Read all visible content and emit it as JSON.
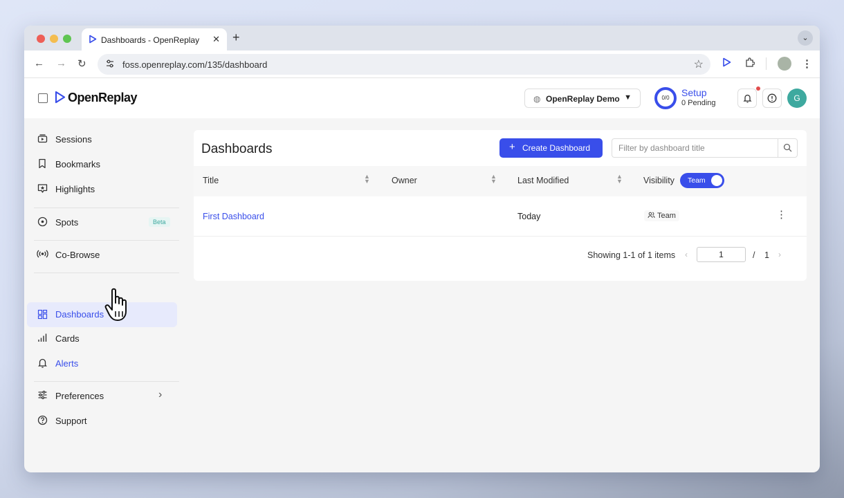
{
  "browser": {
    "tab_title": "Dashboards - OpenReplay",
    "tab_close": "✕",
    "new_tab": "+",
    "tab_menu": "⌄",
    "url": "foss.openreplay.com/135/dashboard"
  },
  "header": {
    "logo": "OpenReplay",
    "project": "OpenReplay Demo",
    "setup_progress": "0/0",
    "setup_title": "Setup",
    "setup_sub": "0 Pending",
    "user_initial": "G"
  },
  "sidebar": {
    "items": [
      {
        "label": "Sessions",
        "icon": "sessions-icon"
      },
      {
        "label": "Bookmarks",
        "icon": "bookmark-icon"
      },
      {
        "label": "Highlights",
        "icon": "highlights-icon"
      },
      {
        "label": "Spots",
        "icon": "spot-icon",
        "badge": "Beta"
      },
      {
        "label": "Co-Browse",
        "icon": "broadcast-icon"
      },
      {
        "label": "Dashboards",
        "icon": "dashboard-icon",
        "active": true
      },
      {
        "label": "Cards",
        "icon": "bar-chart-icon"
      },
      {
        "label": "Alerts",
        "icon": "bell-icon"
      },
      {
        "label": "Preferences",
        "icon": "sliders-icon"
      },
      {
        "label": "Support",
        "icon": "help-icon"
      }
    ]
  },
  "main": {
    "title": "Dashboards",
    "create_button": "Create Dashboard",
    "filter_placeholder": "Filter by dashboard title",
    "columns": [
      "Title",
      "Owner",
      "Last Modified",
      "Visibility"
    ],
    "visibility_toggle": "Team",
    "rows": [
      {
        "title": "First Dashboard",
        "owner": "",
        "last_modified": "Today",
        "visibility": "Team"
      }
    ],
    "pagination": {
      "showing": "Showing 1-1 of 1 items",
      "page": "1",
      "separator": "/",
      "total_pages": "1"
    }
  },
  "colors": {
    "accent": "#394eea",
    "teal": "#3ea99f",
    "active_bg": "#e7eafc"
  }
}
